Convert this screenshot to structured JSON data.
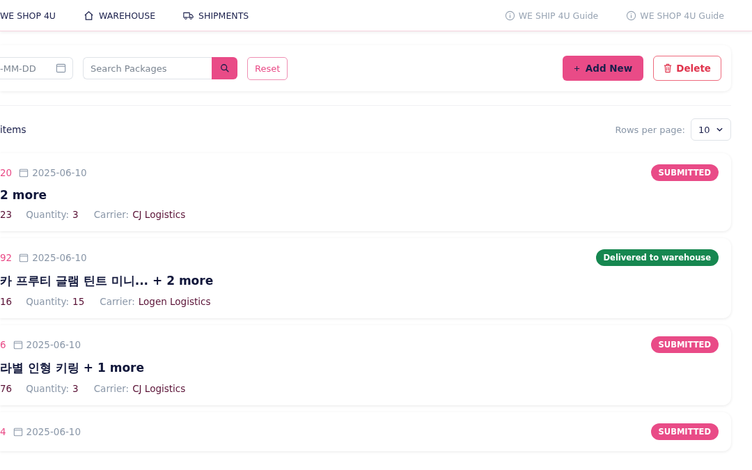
{
  "nav": {
    "items": [
      {
        "label": "WE SHOP 4U",
        "kind": "plain"
      },
      {
        "label": "WAREHOUSE",
        "kind": "warehouse"
      },
      {
        "label": "SHIPMENTS",
        "kind": "shipments"
      }
    ],
    "guides": [
      "WE SHIP 4U Guide",
      "WE SHOP 4U Guide"
    ]
  },
  "toolbar": {
    "date_placeholder": "-MM-DD",
    "search_placeholder": "Search Packages",
    "reset": "Reset",
    "add": "Add New",
    "delete": "Delete"
  },
  "summary": {
    "count": "items",
    "rows_label": "Rows per page:",
    "rows_value": "10"
  },
  "packages": [
    {
      "id": "20",
      "date": "2025-06-10",
      "title": "2 more",
      "code": "23",
      "quantity_label": "Quantity:",
      "quantity": "3",
      "carrier_label": "Carrier:",
      "carrier": "CJ Logistics",
      "status": "SUBMITTED",
      "color": "#e94b87"
    },
    {
      "id": "92",
      "date": "2025-06-10",
      "title": "카 프루티 글램 틴트 미니... + 2 more",
      "code": "16",
      "quantity_label": "Quantity:",
      "quantity": "15",
      "carrier_label": "Carrier:",
      "carrier": "Logen Logistics",
      "status": "Delivered to warehouse",
      "color": "#168750"
    },
    {
      "id": "6",
      "date": "2025-06-10",
      "title": "라별 인형 키링 + 1 more",
      "code": "76",
      "quantity_label": "Quantity:",
      "quantity": "3",
      "carrier_label": "Carrier:",
      "carrier": "CJ Logistics",
      "status": "SUBMITTED",
      "color": "#e94b87"
    },
    {
      "id": "4",
      "date": "2025-06-10",
      "status": "SUBMITTED",
      "color": "#e94b87"
    }
  ]
}
